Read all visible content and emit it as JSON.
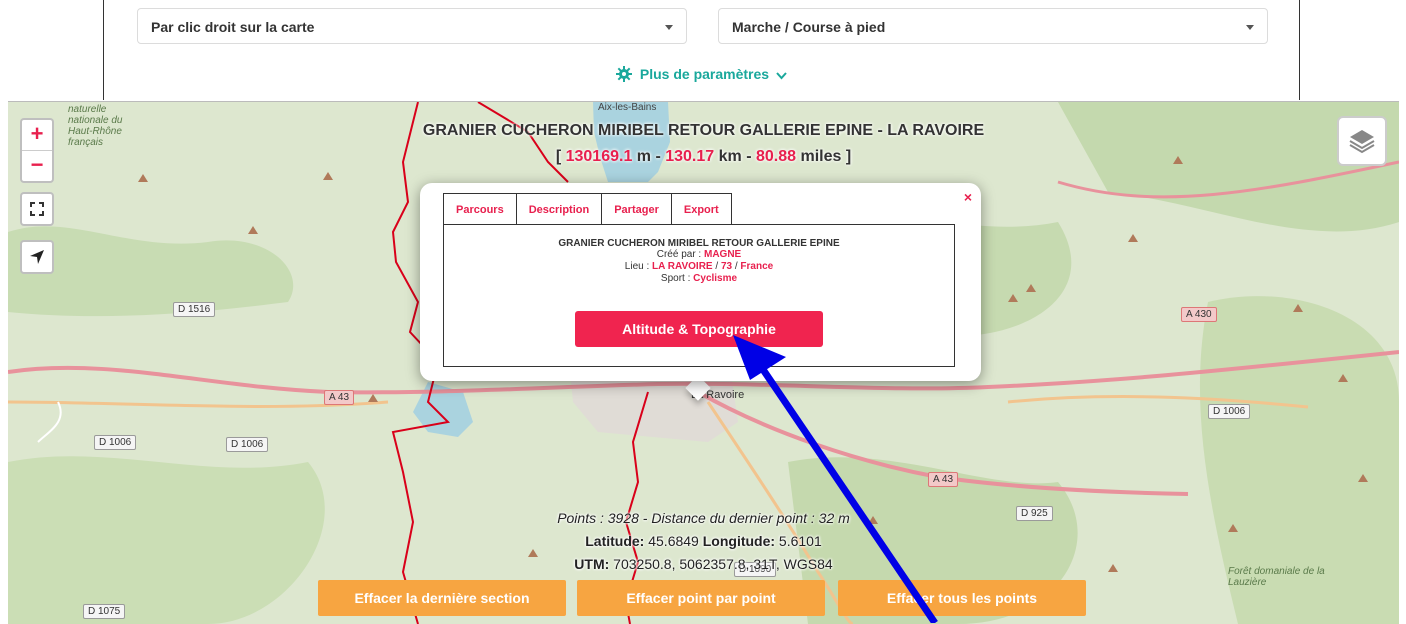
{
  "settings": {
    "placement_mode": "Par clic droit sur la carte",
    "activity": "Marche / Course à pied",
    "more_params": "Plus de paramètres"
  },
  "map": {
    "route_title": "GRANIER CUCHERON MIRIBEL RETOUR GALLERIE EPINE - LA RAVOIRE",
    "distance": {
      "open": "[ ",
      "meters": "130169.1",
      "m_sep": " m - ",
      "km": "130.17",
      "km_sep": " km - ",
      "miles": "80.88",
      "close": " miles ]"
    },
    "labels": {
      "aix": "Aix-les-Bains",
      "ravoire": "La Ravoire",
      "reserve": "naturelle nationale du Haut-Rhône français",
      "foret": "Forêt domaniale de la Lauzière"
    },
    "roads": [
      "D 1516",
      "A 43",
      "D 1006",
      "D 1006",
      "A 43",
      "D 925",
      "D 1075",
      "A 430",
      "D 1006",
      "D 1090"
    ],
    "controls": {
      "zoom_in": "+",
      "zoom_out": "−"
    }
  },
  "popup": {
    "close": "×",
    "tabs": [
      "Parcours",
      "Description",
      "Partager",
      "Export"
    ],
    "title": "GRANIER CUCHERON MIRIBEL RETOUR GALLERIE EPINE",
    "created_label": "Créé par : ",
    "created_by": "MAGNE",
    "place_label": "Lieu : ",
    "place_town": "LA RAVOIRE",
    "place_sep1": " / ",
    "place_dept": "73",
    "place_sep2": " / ",
    "place_country": "France",
    "sport_label": "Sport : ",
    "sport": "Cyclisme",
    "button": "Altitude & Topographie"
  },
  "info": {
    "points_line": "Points : 3928 - Distance du dernier point : 32 m",
    "lat_label": "Latitude:",
    "lat": " 45.6849 ",
    "lon_label": "Longitude:",
    "lon": " 5.6101",
    "utm_label": "UTM:",
    "utm": " 703250.8, 5062357.8, 31T, WGS84"
  },
  "buttons": {
    "erase_last": "Effacer la dernière section",
    "erase_point": "Effacer point par point",
    "erase_all": "Effacer tous les points"
  },
  "colors": {
    "accent_red": "#e8204e",
    "teal": "#1aa89c",
    "orange": "#f7a541",
    "arrow_blue": "#0000e6"
  }
}
